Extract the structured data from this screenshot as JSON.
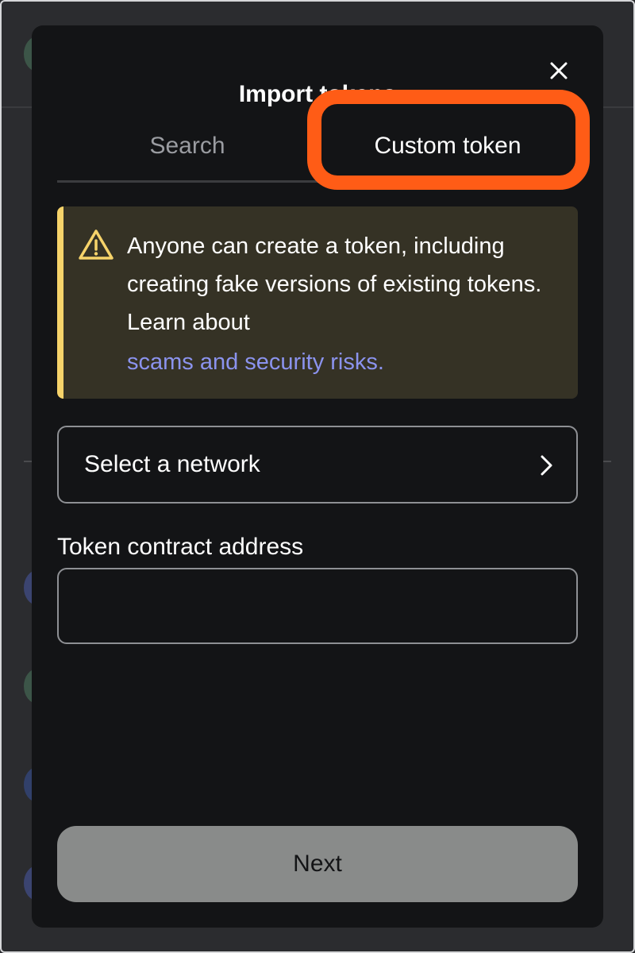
{
  "modal": {
    "title": "Import tokens",
    "close_icon": "close-icon"
  },
  "tabs": [
    {
      "label": "Search",
      "active": false
    },
    {
      "label": "Custom token",
      "active": true
    }
  ],
  "highlight_color": "#ff5c16",
  "warning": {
    "icon": "warning-triangle-icon",
    "text": "Anyone can create a token, including creating fake versions of existing tokens. Learn about",
    "link_text": "scams and security risks.",
    "accent_color": "#f6d36a",
    "link_color": "#8b93ee"
  },
  "network_select": {
    "label": "Select a network",
    "icon": "chevron-right-icon"
  },
  "contract_address": {
    "label": "Token contract address",
    "value": ""
  },
  "next_button": {
    "label": "Next",
    "disabled": true
  }
}
